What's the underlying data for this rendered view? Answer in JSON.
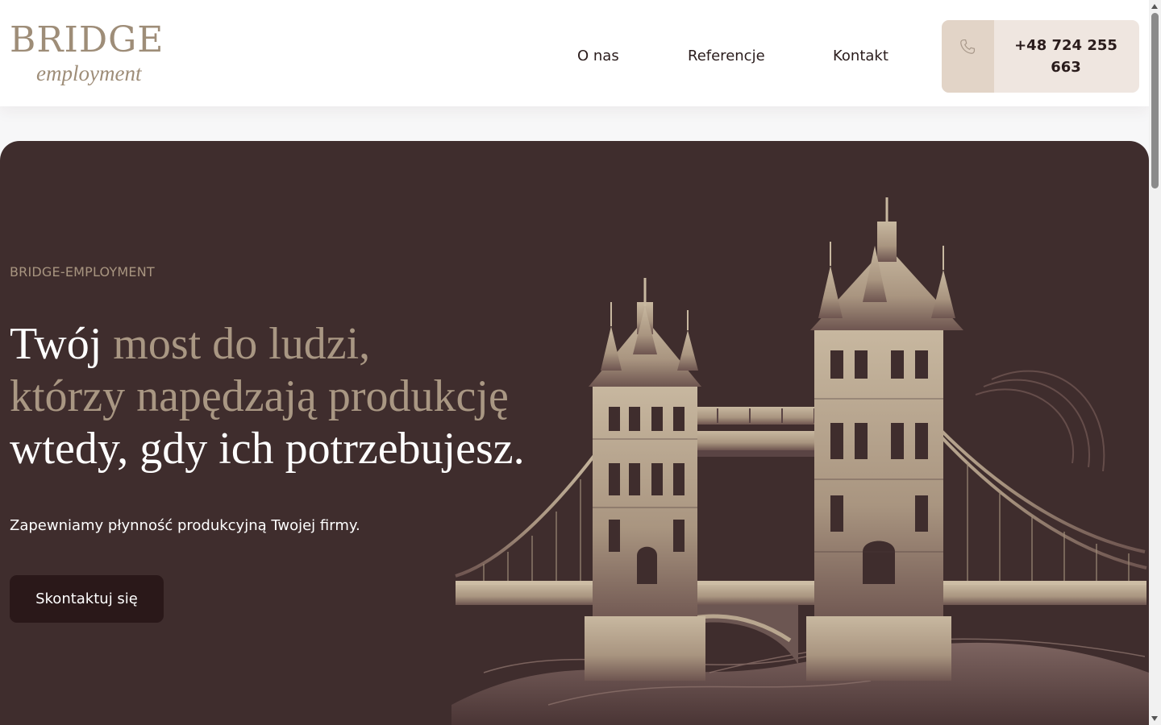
{
  "header": {
    "logo": {
      "main": "BRIDGE",
      "sub": "employment"
    },
    "nav": [
      {
        "label": "O nas"
      },
      {
        "label": "Referencje"
      },
      {
        "label": "Kontakt"
      }
    ],
    "phone": {
      "icon": "phone-icon",
      "number": "+48 724 255 663"
    }
  },
  "hero": {
    "eyebrow": "BRIDGE-EMPLOYMENT",
    "headline": {
      "part1": "Twój",
      "part2": "most do ludzi,",
      "part3": "którzy napędzają produkcję",
      "part4": "wtedy, gdy ich potrzebujesz."
    },
    "subtext": "Zapewniamy płynność produkcyjną Twojej firmy.",
    "cta_label": "Skontaktuj się",
    "illustration": "tower-bridge-illustration"
  },
  "colors": {
    "hero_background": "#3f2d2d",
    "accent": "#a99783",
    "cta_background": "#2a1819",
    "phone_button": "#efe6e0",
    "phone_icon_box": "#e2d4c7",
    "logo": "#9e8d78"
  }
}
